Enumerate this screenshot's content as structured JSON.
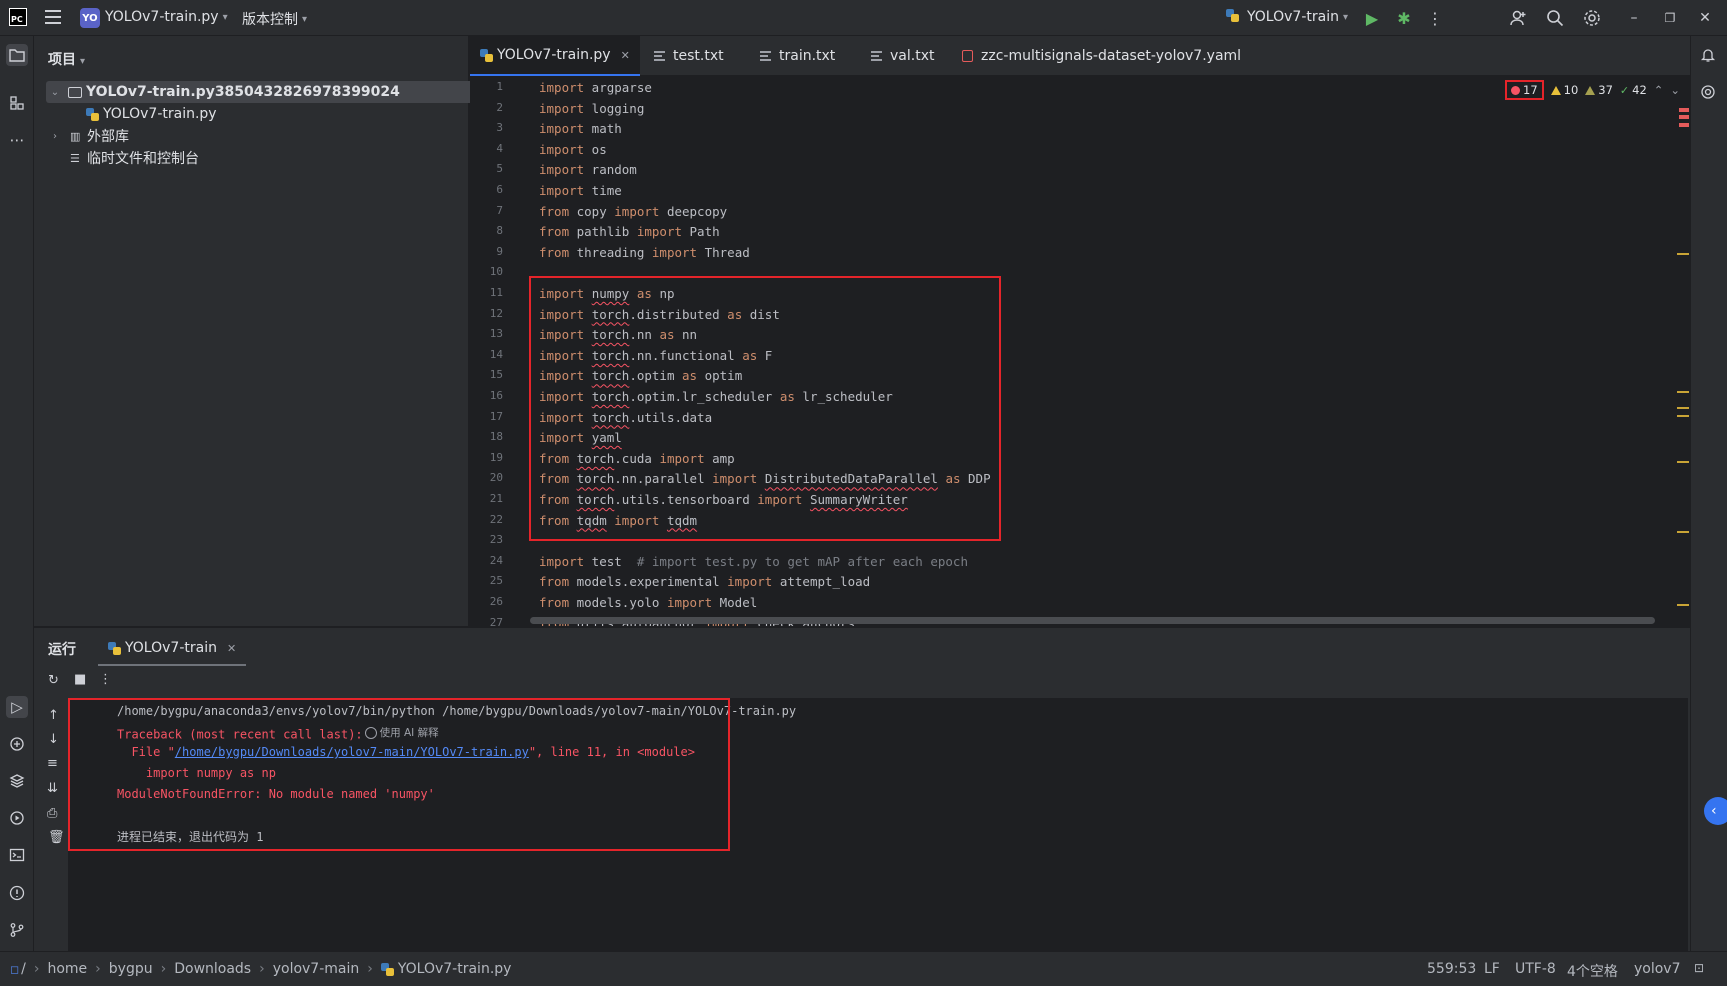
{
  "titlebar": {
    "project_badge": "YO",
    "project_name": "YOLOv7-train.py",
    "vcs_label": "版本控制",
    "run_config": "YOLOv7-train"
  },
  "project_panel": {
    "title": "项目",
    "tree": [
      {
        "label": "YOLOv7-train.py3850432826978399024",
        "type": "folder",
        "expanded": true,
        "selected": true
      },
      {
        "label": "YOLOv7-train.py",
        "type": "python-file"
      },
      {
        "label": "外部库",
        "type": "library",
        "expanded": false
      },
      {
        "label": "临时文件和控制台",
        "type": "scratches"
      }
    ]
  },
  "editor": {
    "tabs": [
      {
        "label": "YOLOv7-train.py",
        "type": "python",
        "active": true
      },
      {
        "label": "test.txt",
        "type": "text"
      },
      {
        "label": "train.txt",
        "type": "text"
      },
      {
        "label": "val.txt",
        "type": "text"
      },
      {
        "label": "zzc-multisignals-dataset-yolov7.yaml",
        "type": "yaml"
      }
    ],
    "inspections": {
      "errors": "17",
      "warnings": "10",
      "weak_warnings": "37",
      "typos": "42"
    },
    "line_numbers": [
      "1",
      "2",
      "3",
      "4",
      "5",
      "6",
      "7",
      "8",
      "9",
      "10",
      "11",
      "12",
      "13",
      "14",
      "15",
      "16",
      "17",
      "18",
      "19",
      "20",
      "21",
      "22",
      "23",
      "24",
      "25",
      "26",
      "27"
    ],
    "lines": [
      [
        {
          "t": "import",
          "k": "kw"
        },
        {
          "t": " argparse"
        }
      ],
      [
        {
          "t": "import",
          "k": "kw"
        },
        {
          "t": " logging"
        }
      ],
      [
        {
          "t": "import",
          "k": "kw"
        },
        {
          "t": " math"
        }
      ],
      [
        {
          "t": "import",
          "k": "kw"
        },
        {
          "t": " os"
        }
      ],
      [
        {
          "t": "import",
          "k": "kw"
        },
        {
          "t": " random"
        }
      ],
      [
        {
          "t": "import",
          "k": "kw"
        },
        {
          "t": " time"
        }
      ],
      [
        {
          "t": "from",
          "k": "kw"
        },
        {
          "t": " copy "
        },
        {
          "t": "import",
          "k": "kw"
        },
        {
          "t": " deepcopy"
        }
      ],
      [
        {
          "t": "from",
          "k": "kw"
        },
        {
          "t": " pathlib "
        },
        {
          "t": "import",
          "k": "kw"
        },
        {
          "t": " Path"
        }
      ],
      [
        {
          "t": "from",
          "k": "kw"
        },
        {
          "t": " threading "
        },
        {
          "t": "import",
          "k": "kw"
        },
        {
          "t": " Thread"
        }
      ],
      [],
      [
        {
          "t": "import",
          "k": "kw"
        },
        {
          "t": " "
        },
        {
          "t": "numpy",
          "k": "err"
        },
        {
          "t": " "
        },
        {
          "t": "as",
          "k": "kw"
        },
        {
          "t": " np"
        }
      ],
      [
        {
          "t": "import",
          "k": "kw"
        },
        {
          "t": " "
        },
        {
          "t": "torch",
          "k": "err"
        },
        {
          "t": ".distributed "
        },
        {
          "t": "as",
          "k": "kw"
        },
        {
          "t": " dist"
        }
      ],
      [
        {
          "t": "import",
          "k": "kw"
        },
        {
          "t": " "
        },
        {
          "t": "torch",
          "k": "err"
        },
        {
          "t": ".nn "
        },
        {
          "t": "as",
          "k": "kw"
        },
        {
          "t": " nn"
        }
      ],
      [
        {
          "t": "import",
          "k": "kw"
        },
        {
          "t": " "
        },
        {
          "t": "torch",
          "k": "err"
        },
        {
          "t": ".nn.functional "
        },
        {
          "t": "as",
          "k": "kw"
        },
        {
          "t": " F"
        }
      ],
      [
        {
          "t": "import",
          "k": "kw"
        },
        {
          "t": " "
        },
        {
          "t": "torch",
          "k": "err"
        },
        {
          "t": ".optim "
        },
        {
          "t": "as",
          "k": "kw"
        },
        {
          "t": " optim"
        }
      ],
      [
        {
          "t": "import",
          "k": "kw"
        },
        {
          "t": " "
        },
        {
          "t": "torch",
          "k": "err"
        },
        {
          "t": ".optim.lr_scheduler "
        },
        {
          "t": "as",
          "k": "kw"
        },
        {
          "t": " lr_scheduler"
        }
      ],
      [
        {
          "t": "import",
          "k": "kw"
        },
        {
          "t": " "
        },
        {
          "t": "torch",
          "k": "err"
        },
        {
          "t": ".utils.data"
        }
      ],
      [
        {
          "t": "import",
          "k": "kw"
        },
        {
          "t": " "
        },
        {
          "t": "yaml",
          "k": "err"
        }
      ],
      [
        {
          "t": "from",
          "k": "kw"
        },
        {
          "t": " "
        },
        {
          "t": "torch",
          "k": "err"
        },
        {
          "t": ".cuda "
        },
        {
          "t": "import",
          "k": "kw"
        },
        {
          "t": " amp"
        }
      ],
      [
        {
          "t": "from",
          "k": "kw"
        },
        {
          "t": " "
        },
        {
          "t": "torch",
          "k": "err"
        },
        {
          "t": ".nn.parallel "
        },
        {
          "t": "import",
          "k": "kw"
        },
        {
          "t": " "
        },
        {
          "t": "DistributedDataParallel",
          "k": "err"
        },
        {
          "t": " "
        },
        {
          "t": "as",
          "k": "kw"
        },
        {
          "t": " DDP"
        }
      ],
      [
        {
          "t": "from",
          "k": "kw"
        },
        {
          "t": " "
        },
        {
          "t": "torch",
          "k": "err"
        },
        {
          "t": ".utils.tensorboard "
        },
        {
          "t": "import",
          "k": "kw"
        },
        {
          "t": " "
        },
        {
          "t": "SummaryWriter",
          "k": "err"
        }
      ],
      [
        {
          "t": "from",
          "k": "kw"
        },
        {
          "t": " "
        },
        {
          "t": "tqdm",
          "k": "err"
        },
        {
          "t": " "
        },
        {
          "t": "import",
          "k": "kw"
        },
        {
          "t": " "
        },
        {
          "t": "tqdm",
          "k": "err"
        }
      ],
      [],
      [
        {
          "t": "import",
          "k": "kw"
        },
        {
          "t": " test  "
        },
        {
          "t": "# import test.py to get mAP after each epoch",
          "k": "cm"
        }
      ],
      [
        {
          "t": "from",
          "k": "kw"
        },
        {
          "t": " models.experimental "
        },
        {
          "t": "import",
          "k": "kw"
        },
        {
          "t": " attempt_load"
        }
      ],
      [
        {
          "t": "from",
          "k": "kw"
        },
        {
          "t": " models.yolo "
        },
        {
          "t": "import",
          "k": "kw"
        },
        {
          "t": " Model"
        }
      ],
      [
        {
          "t": "from",
          "k": "kw"
        },
        {
          "t": " utils.autoanchor "
        },
        {
          "t": "import",
          "k": "kw"
        },
        {
          "t": " check_anchors"
        }
      ]
    ]
  },
  "run_panel": {
    "title": "运行",
    "tab_label": "YOLOv7-train",
    "console": {
      "cmd": "/home/bygpu/anaconda3/envs/yolov7/bin/python /home/bygpu/Downloads/yolov7-main/YOLOv7-train.py",
      "traceback": "Traceback (most recent call last):",
      "ai_explain": "使用 AI 解释",
      "file_prefix": "  File \"",
      "file_link": "/home/bygpu/Downloads/yolov7-main/YOLOv7-train.py",
      "file_suffix": "\", line 11, in <module>",
      "code_line": "    import numpy as np",
      "error": "ModuleNotFoundError: No module named 'numpy'",
      "exit": "进程已结束，退出代码为 1"
    }
  },
  "statusbar": {
    "breadcrumbs": [
      "home",
      "bygpu",
      "Downloads",
      "yolov7-main",
      "YOLOv7-train.py"
    ],
    "position": "559:53",
    "line_sep": "LF",
    "encoding": "UTF-8",
    "indent": "4个空格",
    "interpreter": "yolov7"
  },
  "colors": {
    "accent": "#3574f0",
    "error": "#f75464",
    "highlight_box": "#e5242a"
  }
}
